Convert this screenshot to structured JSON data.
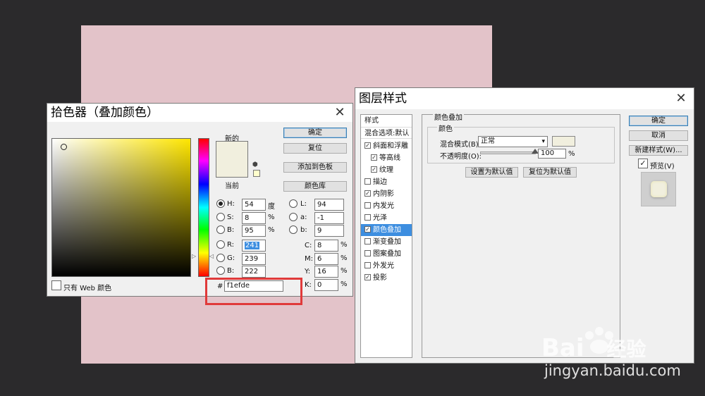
{
  "picker": {
    "title": "拾色器（叠加颜色）",
    "close_glyph": "✕",
    "new_label": "新的",
    "current_label": "当前",
    "new_color": "#f1efde",
    "current_color": "#f1efde",
    "buttons": {
      "ok": "确定",
      "reset": "复位",
      "add_swatch": "添加到色板",
      "libraries": "颜色库"
    },
    "fields": {
      "h": {
        "label": "H:",
        "value": "54",
        "unit": "度"
      },
      "s": {
        "label": "S:",
        "value": "8",
        "unit": "%"
      },
      "b": {
        "label": "B:",
        "value": "95",
        "unit": "%"
      },
      "r": {
        "label": "R:",
        "value": "241"
      },
      "g": {
        "label": "G:",
        "value": "239"
      },
      "bl": {
        "label": "B:",
        "value": "222"
      },
      "l": {
        "label": "L:",
        "value": "94"
      },
      "a": {
        "label": "a:",
        "value": "-1"
      },
      "b2": {
        "label": "b:",
        "value": "9"
      },
      "c": {
        "label": "C:",
        "value": "8",
        "unit": "%"
      },
      "m": {
        "label": "M:",
        "value": "6",
        "unit": "%"
      },
      "y": {
        "label": "Y:",
        "value": "16",
        "unit": "%"
      },
      "k": {
        "label": "K:",
        "value": "0",
        "unit": "%"
      }
    },
    "hex_label": "#",
    "hex_value": "f1efde",
    "web_only_label": "只有 Web 颜色",
    "highlight_color": "#e03a3a"
  },
  "layer_style": {
    "title": "图层样式",
    "close_glyph": "✕",
    "styles_header": "样式",
    "blend_default": "混合选项:默认",
    "items": [
      {
        "label": "斜面和浮雕",
        "checked": "✓"
      },
      {
        "label": "等高线",
        "checked": "✓"
      },
      {
        "label": "纹理",
        "checked": "✓"
      },
      {
        "label": "描边",
        "checked": ""
      },
      {
        "label": "内阴影",
        "checked": "✓"
      },
      {
        "label": "内发光",
        "checked": ""
      },
      {
        "label": "光泽",
        "checked": ""
      },
      {
        "label": "颜色叠加",
        "checked": "✓"
      },
      {
        "label": "渐变叠加",
        "checked": ""
      },
      {
        "label": "图案叠加",
        "checked": ""
      },
      {
        "label": "外发光",
        "checked": ""
      },
      {
        "label": "投影",
        "checked": "✓"
      }
    ],
    "section_title": "颜色叠加",
    "subsection_title": "颜色",
    "blend_mode_label": "混合模式(B):",
    "blend_mode_value": "正常",
    "opacity_label": "不透明度(O):",
    "opacity_value": "100",
    "opacity_unit": "%",
    "overlay_color": "#f1efde",
    "set_default": "设置为默认值",
    "reset_default": "复位为默认值",
    "buttons": {
      "ok": "确定",
      "cancel": "取消",
      "new_style": "新建样式(W)...",
      "preview": "预览(V)"
    },
    "preview_checked": "✓",
    "selected_color": "#3d8ee0"
  },
  "watermark": {
    "brand": "Bai",
    "brand_cn": "经验",
    "url": "jingyan.baidu.com"
  }
}
